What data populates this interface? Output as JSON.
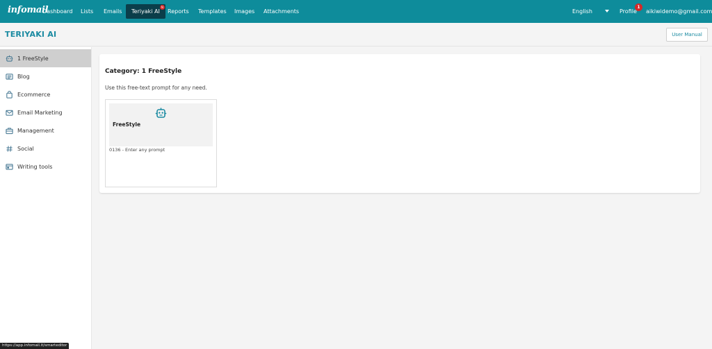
{
  "nav": {
    "logo": "infomail",
    "items": [
      "Dashboard",
      "Lists",
      "Emails",
      "Teriyaki AI",
      "Reports",
      "Templates",
      "Images",
      "Attachments"
    ],
    "active_badge": "N",
    "language": "English",
    "profile": "Profile",
    "notifications": "1",
    "email": "aikiwidemo@gmail.com"
  },
  "header": {
    "title": "TERIYAKI AI",
    "user_manual": "User Manual"
  },
  "sidebar": {
    "items": [
      {
        "label": "1 FreeStyle",
        "icon": "robot-icon"
      },
      {
        "label": "Blog",
        "icon": "newspaper-icon"
      },
      {
        "label": "Ecommerce",
        "icon": "shopping-bag-icon"
      },
      {
        "label": "Email Marketing",
        "icon": "envelope-icon"
      },
      {
        "label": "Management",
        "icon": "briefcase-icon"
      },
      {
        "label": "Social",
        "icon": "hashtag-icon"
      },
      {
        "label": "Writing tools",
        "icon": "tools-icon"
      }
    ]
  },
  "main": {
    "category_title": "Category: 1 FreeStyle",
    "category_desc": "Use this free-text prompt for any need.",
    "tiles": [
      {
        "name": "FreeStyle",
        "desc": "0136 - Enter any prompt",
        "icon": "robot-icon"
      }
    ]
  },
  "status_url": "https://app.infomail.it/smarteditor",
  "colors": {
    "brand": "#0e8c9b",
    "accent_text": "#1a8aa1",
    "active_tab": "#0b3e4a",
    "badge": "#d62828"
  }
}
